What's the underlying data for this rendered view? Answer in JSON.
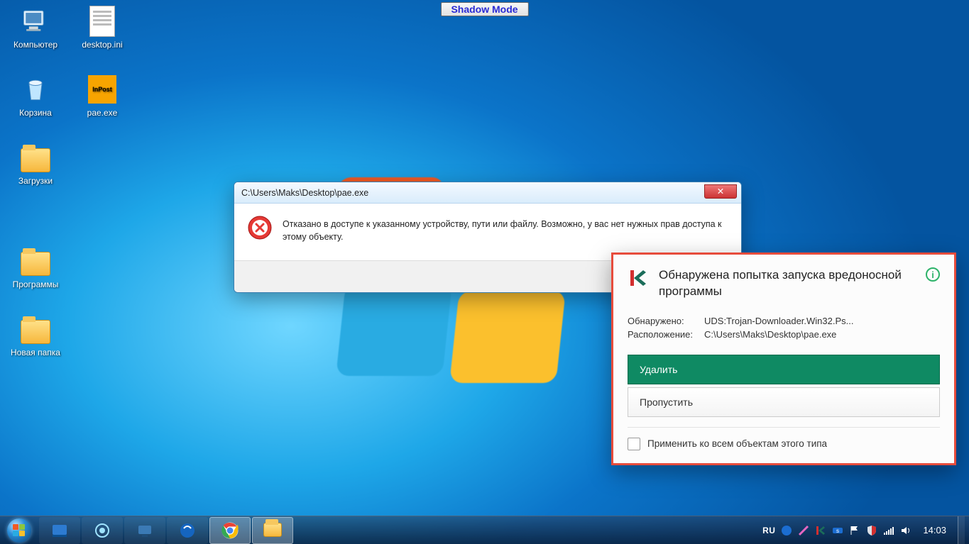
{
  "shadow_mode_label": "Shadow Mode",
  "desktop_icons": [
    {
      "label": "Компьютер",
      "kind": "pc"
    },
    {
      "label": "desktop.ini",
      "kind": "ini"
    },
    {
      "label": "Корзина",
      "kind": "bin"
    },
    {
      "label": "pae.exe",
      "kind": "exe",
      "badge": "InPost"
    },
    {
      "label": "Загрузки",
      "kind": "folder"
    },
    {
      "label": "Программы",
      "kind": "folder"
    },
    {
      "label": "Новая папка",
      "kind": "folder"
    }
  ],
  "error_dialog": {
    "title": "C:\\Users\\Maks\\Desktop\\pae.exe",
    "message": "Отказано в доступе к указанному устройству, пути или файлу. Возможно,  у вас нет нужных прав доступа к этому объекту.",
    "close_glyph": "✕"
  },
  "kaspersky": {
    "title": "Обнаружена попытка запуска вредоносной программы",
    "detected_label": "Обнаружено:",
    "detected_value": "UDS:Trojan-Downloader.Win32.Ps...",
    "location_label": "Расположение:",
    "location_value": "C:\\Users\\Maks\\Desktop\\pae.exe",
    "btn_delete": "Удалить",
    "btn_skip": "Пропустить",
    "apply_all": "Применить ко всем объектам этого типа",
    "info_glyph": "i"
  },
  "taskbar": {
    "lang": "RU",
    "time": "14:03"
  }
}
